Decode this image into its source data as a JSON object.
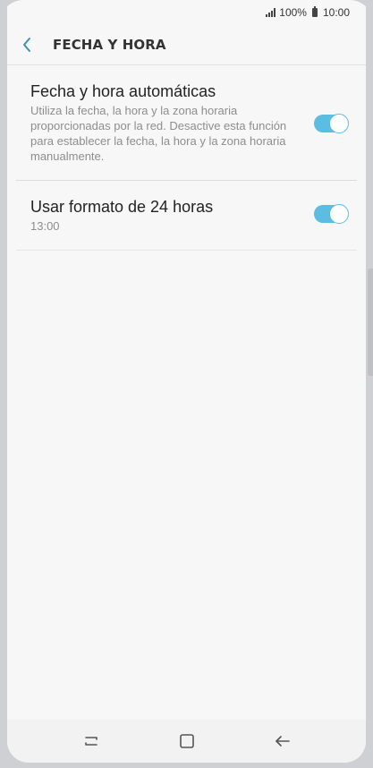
{
  "status_bar": {
    "battery": "100%",
    "time": "10:00"
  },
  "header": {
    "title": "FECHA Y HORA",
    "back_icon": "chevron-left-icon"
  },
  "settings": [
    {
      "title": "Fecha y hora automáticas",
      "subtitle": "Utiliza la fecha, la hora y la zona horaria proporcionadas por la red. Desactive esta función para establecer la fecha, la hora y la zona horaria manualmente.",
      "toggle_on": true
    },
    {
      "title": "Usar formato de 24 horas",
      "subtitle": "13:00",
      "toggle_on": true
    }
  ],
  "nav_bar": {
    "recent_icon": "recent-apps-icon",
    "home_icon": "home-icon",
    "back_icon": "back-arrow-icon"
  },
  "colors": {
    "accent": "#5bbde1",
    "background": "#f7f7f7"
  }
}
